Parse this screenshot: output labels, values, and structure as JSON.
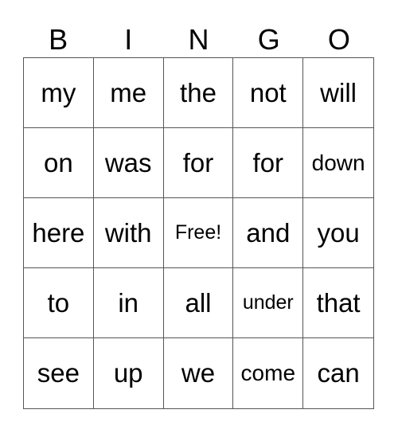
{
  "header": [
    "B",
    "I",
    "N",
    "G",
    "O"
  ],
  "rows": [
    [
      "my",
      "me",
      "the",
      "not",
      "will"
    ],
    [
      "on",
      "was",
      "for",
      "for",
      "down"
    ],
    [
      "here",
      "with",
      "Free!",
      "and",
      "you"
    ],
    [
      "to",
      "in",
      "all",
      "under",
      "that"
    ],
    [
      "see",
      "up",
      "we",
      "come",
      "can"
    ]
  ]
}
